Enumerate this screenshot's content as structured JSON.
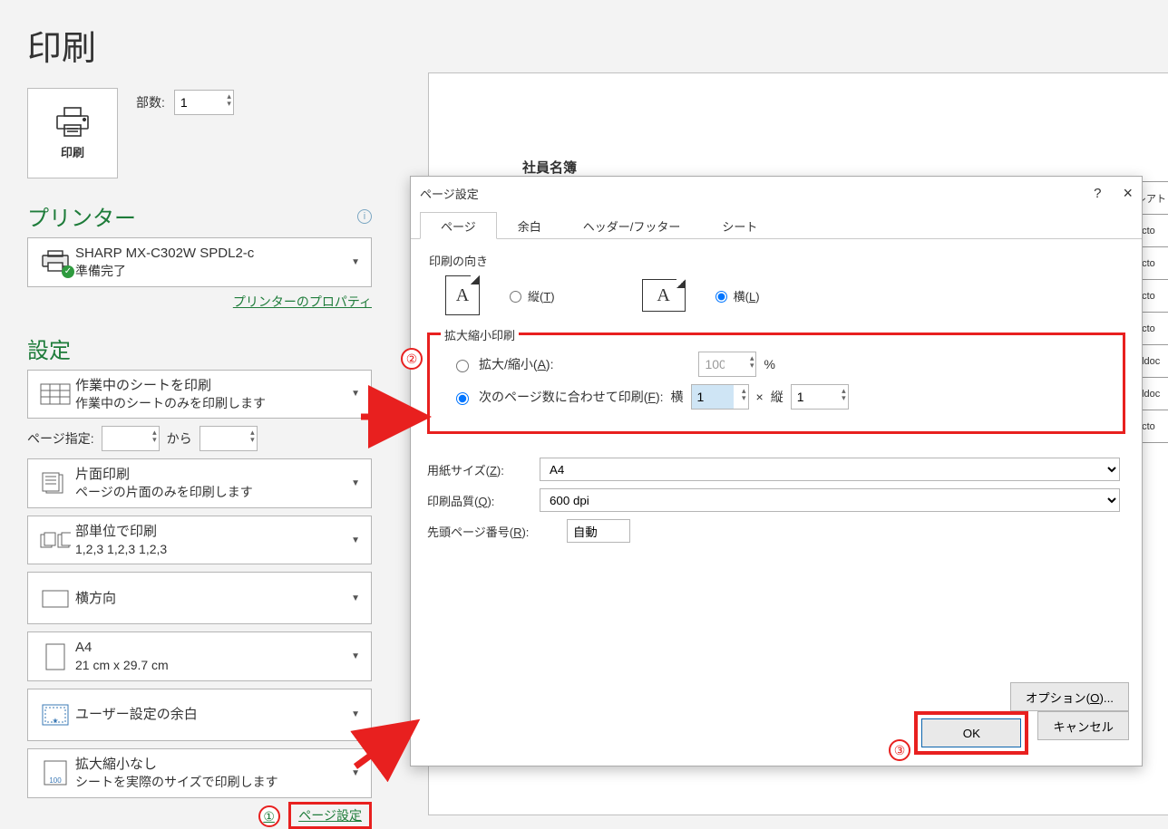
{
  "title": "印刷",
  "copies": {
    "label": "部数:",
    "value": "1"
  },
  "print_button_label": "印刷",
  "printer_section": "プリンター",
  "printer": {
    "name": "SHARP MX-C302W SPDL2-c",
    "status": "準備完了"
  },
  "printer_properties_link": "プリンターのプロパティ",
  "settings_section": "設定",
  "settings": {
    "print_area": {
      "title": "作業中のシートを印刷",
      "sub": "作業中のシートのみを印刷します"
    },
    "page_range_label": "ページ指定:",
    "page_from": "",
    "page_to_label": "から",
    "page_to": "",
    "duplex": {
      "title": "片面印刷",
      "sub": "ページの片面のみを印刷します"
    },
    "collate": {
      "title": "部単位で印刷",
      "sub": "1,2,3    1,2,3    1,2,3"
    },
    "orientation": {
      "title": "横方向"
    },
    "paper": {
      "title": "A4",
      "sub": "21 cm x 29.7 cm"
    },
    "margins": {
      "title": "ユーザー設定の余白"
    },
    "scaling": {
      "title": "拡大縮小なし",
      "sub": "シートを実際のサイズで印刷します"
    }
  },
  "page_setup_link": "ページ設定",
  "preview": {
    "doc_title": "社員名簿",
    "side_header": "レアト",
    "side_cells": [
      "octo",
      "octo",
      "octo",
      "octo",
      "eldoc",
      "eldoc",
      "octo"
    ]
  },
  "dialog": {
    "title": "ページ設定",
    "help": "?",
    "close": "×",
    "tabs": [
      "ページ",
      "余白",
      "ヘッダー/フッター",
      "シート"
    ],
    "orient_group": "印刷の向き",
    "orient_portrait": "縦(T)",
    "orient_landscape": "横(L)",
    "scaling_group": "拡大縮小印刷",
    "scale_adjust": "拡大/縮小(A):",
    "scale_adjust_value": "100",
    "scale_adjust_unit": "%",
    "scale_fit": "次のページ数に合わせて印刷(F):",
    "fit_w_label": "横",
    "fit_w_value": "1",
    "fit_x": "×",
    "fit_h_label": "縦",
    "fit_h_value": "1",
    "paper_size_label": "用紙サイズ(Z):",
    "paper_size_value": "A4",
    "print_quality_label": "印刷品質(Q):",
    "print_quality_value": "600 dpi",
    "first_page_label": "先頭ページ番号(R):",
    "first_page_value": "自動",
    "options_button": "オプション(O)...",
    "ok": "OK",
    "cancel": "キャンセル"
  },
  "annotations": {
    "a1": "①",
    "a2": "②",
    "a3": "③"
  }
}
